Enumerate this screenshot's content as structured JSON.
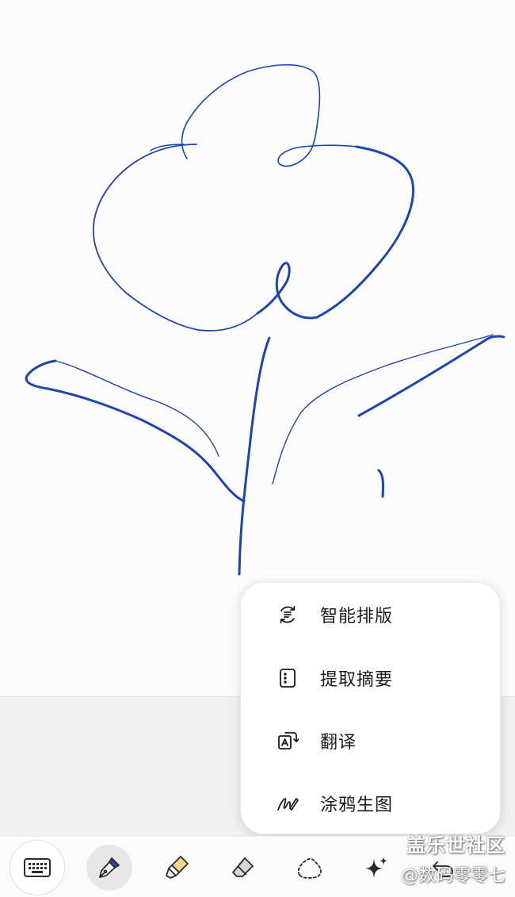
{
  "menu": {
    "items": [
      {
        "label": "智能排版",
        "icon": "smart-layout-icon"
      },
      {
        "label": "提取摘要",
        "icon": "extract-summary-icon"
      },
      {
        "label": "翻译",
        "icon": "translate-icon"
      },
      {
        "label": "涂鸦生图",
        "icon": "doodle-to-image-icon"
      }
    ]
  },
  "toolbar": {
    "tools": [
      "keyboard-icon",
      "pen-icon",
      "highlighter-icon",
      "eraser-icon",
      "lasso-icon",
      "ai-sparkle-icon",
      "undo-icon"
    ],
    "pen_color": "#1f47b4",
    "highlighter_color": "#f4d88a"
  },
  "canvas": {
    "ink_color": "#1e45ad"
  },
  "watermark": {
    "line1": "盖乐世社区",
    "line2": "@数码零零七"
  }
}
